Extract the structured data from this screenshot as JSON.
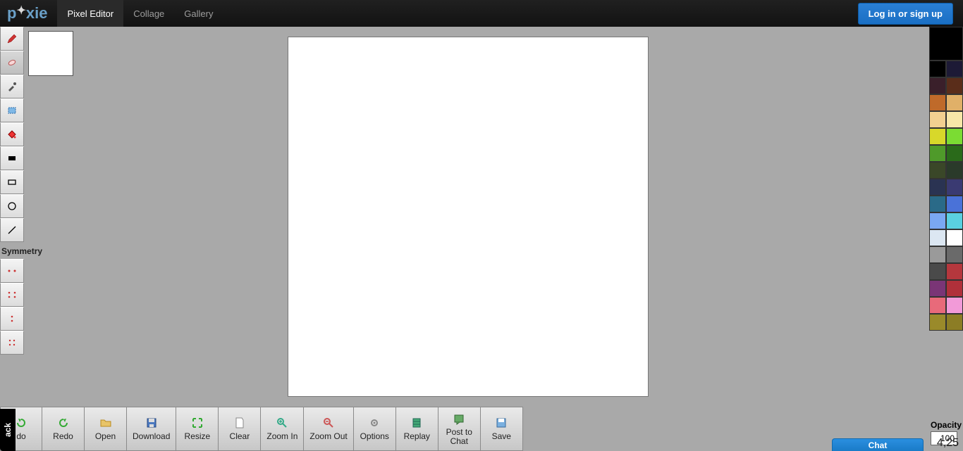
{
  "logo": {
    "text": "p",
    "text2": "xie"
  },
  "nav": [
    {
      "label": "Pixel Editor",
      "active": true
    },
    {
      "label": "Collage",
      "active": false
    },
    {
      "label": "Gallery",
      "active": false
    }
  ],
  "login_label": "Log in or sign up",
  "symmetry_label": "Symmetry",
  "tools": [
    {
      "name": "pencil",
      "active": false
    },
    {
      "name": "eraser",
      "active": true
    },
    {
      "name": "eyedropper",
      "active": false
    },
    {
      "name": "marquee",
      "active": false
    },
    {
      "name": "bucket",
      "active": false
    },
    {
      "name": "fill-rect",
      "active": false
    },
    {
      "name": "rect-outline",
      "active": false
    },
    {
      "name": "circle-outline",
      "active": false
    },
    {
      "name": "line",
      "active": false
    }
  ],
  "symmetry_tools": [
    {
      "name": "sym-horizontal"
    },
    {
      "name": "sym-vertical"
    },
    {
      "name": "sym-single"
    },
    {
      "name": "sym-quad"
    }
  ],
  "palette_current": "#000000",
  "palette": [
    "#000000",
    "#1d1a36",
    "#3a1f2a",
    "#5a2d1a",
    "#bf6a2a",
    "#e0b068",
    "#f2d090",
    "#f7e7a8",
    "#d8d82a",
    "#7bdc33",
    "#4f9a2a",
    "#2a6a1a",
    "#3a4728",
    "#2a3a2a",
    "#2a3352",
    "#3a3a72",
    "#2a6a88",
    "#4a72d8",
    "#7aa8f2",
    "#5ad0e0",
    "#dce7f2",
    "#ffffff",
    "#9a9a9a",
    "#6a6a6a",
    "#4a4a4a",
    "#b5373d",
    "#7a3576",
    "#b0303a",
    "#e86a7a",
    "#f29ad8",
    "#9a8a2a",
    "#8c7d25"
  ],
  "opacity": {
    "label": "Opacity",
    "value": "100"
  },
  "actions": [
    {
      "name": "undo",
      "label": "do",
      "label2": "",
      "icon": "undo"
    },
    {
      "name": "redo",
      "label": "Redo",
      "label2": "",
      "icon": "redo"
    },
    {
      "name": "open",
      "label": "Open",
      "label2": "",
      "icon": "folder"
    },
    {
      "name": "download",
      "label": "Download",
      "label2": "",
      "icon": "disk"
    },
    {
      "name": "resize",
      "label": "Resize",
      "label2": "",
      "icon": "resize"
    },
    {
      "name": "clear",
      "label": "Clear",
      "label2": "",
      "icon": "page"
    },
    {
      "name": "zoomin",
      "label": "Zoom In",
      "label2": "",
      "icon": "zoomin"
    },
    {
      "name": "zoomout",
      "label": "Zoom Out",
      "label2": "",
      "icon": "zoomout"
    },
    {
      "name": "options",
      "label": "Options",
      "label2": "",
      "icon": "gear"
    },
    {
      "name": "replay",
      "label": "Replay",
      "label2": "",
      "icon": "film"
    },
    {
      "name": "post",
      "label": "Post to",
      "label2": "Chat",
      "icon": "post"
    },
    {
      "name": "save",
      "label": "Save",
      "label2": "",
      "icon": "save"
    }
  ],
  "side_badge": "ack",
  "chat_label": "Chat",
  "coords": "4,25"
}
